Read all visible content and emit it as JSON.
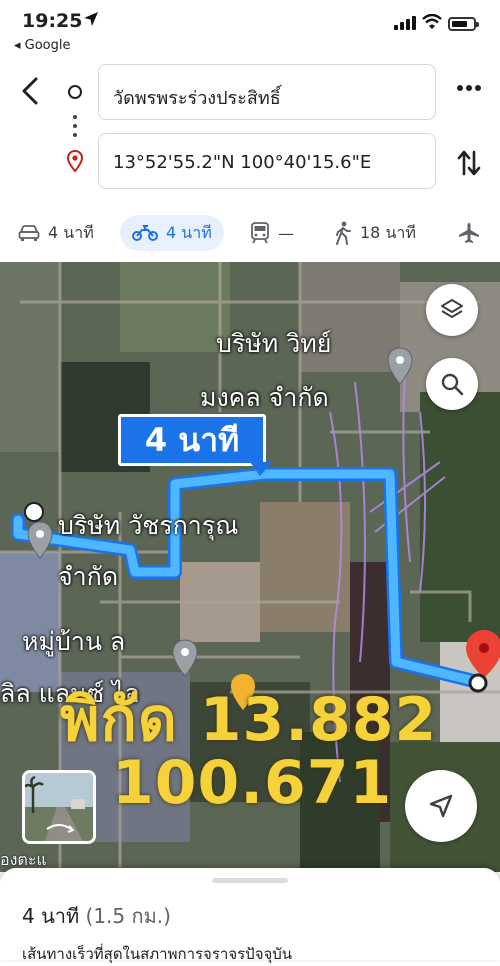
{
  "status_bar": {
    "time": "19:25",
    "back_app": "◂ Google"
  },
  "directions": {
    "origin": "วัดพรพระร่วงประสิทธิ์",
    "destination": "13°52'55.2\"N 100°40'15.6\"E"
  },
  "modes": [
    {
      "name": "car-icon",
      "label": "4 นาที",
      "selected": false
    },
    {
      "name": "motorbike-icon",
      "label": "4 นาที",
      "selected": true
    },
    {
      "name": "transit-icon",
      "label": "—",
      "selected": false
    },
    {
      "name": "walk-icon",
      "label": "18 นาที",
      "selected": false
    },
    {
      "name": "flight-icon",
      "label": "",
      "selected": false
    }
  ],
  "map": {
    "eta_label": "4 นาที",
    "labels": {
      "company_1_line1": "บริษัท วิทย์",
      "company_1_line2": "มงคล จำกัด",
      "company_2_line1": "บริษัท วัชรการุณ",
      "company_2_line2": "จำกัด",
      "village_line1": "หมู่บ้าน ล",
      "village_line2": "ลิล แลนซ์ ไอ",
      "street": "องตะแ"
    },
    "overlay_text": {
      "line1": "พิกัด 13.882",
      "line2": "100.671"
    },
    "route_color": "#4fb7ff",
    "pin_color": "#ea4335"
  },
  "summary": {
    "duration": "4 นาที",
    "distance": "(1.5 กม.)",
    "description": "เส้นทางเร็วที่สุดในสภาพการจราจรปัจจุบัน"
  }
}
